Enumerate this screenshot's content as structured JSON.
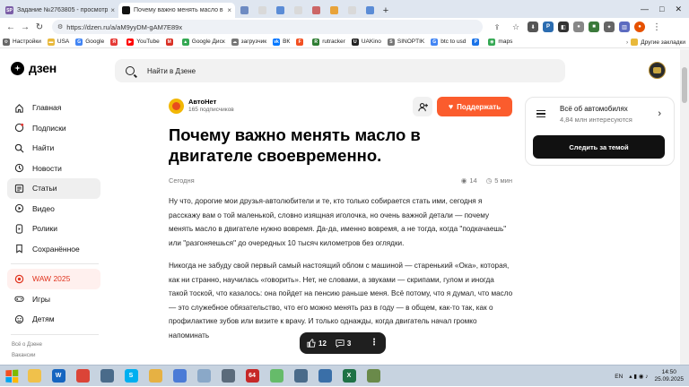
{
  "browser": {
    "tabs": [
      {
        "label": "Задание №2763805 - просмотр з",
        "favicon_text": "SP",
        "favicon_color": "#7b5ea7",
        "active": false
      },
      {
        "label": "Почему важно менять масло в д",
        "favicon_text": "",
        "favicon_color": "#111111",
        "active": true
      }
    ],
    "mini_tab_colors": [
      "#6e8bc2",
      "#d9d9d9",
      "#5b8cd6",
      "#d9d9d9",
      "#c66",
      "#e8a33a",
      "#d9d9d9",
      "#5b8cd6"
    ],
    "new_tab_label": "+",
    "window_controls": [
      "—",
      "□",
      "✕"
    ],
    "url": "https://dzen.ru/a/aM9yyDM-gAM7E89x",
    "bookmarks": [
      {
        "label": "Настройки",
        "icon": "gear-icon",
        "color": "#666666"
      },
      {
        "label": "USA",
        "icon": "folder-icon",
        "color": "#e8b83a"
      },
      {
        "label": "Google",
        "icon": "G",
        "color": "#4285f4"
      },
      {
        "label": "",
        "icon": "Я",
        "color": "#e53935"
      },
      {
        "label": "YouTube",
        "icon": "▶",
        "color": "#ff0000"
      },
      {
        "label": "",
        "icon": "M",
        "color": "#d93025"
      },
      {
        "label": "Google Диск",
        "icon": "▲",
        "color": "#34a853"
      },
      {
        "label": "загрузчик",
        "icon": "☁",
        "color": "#777777"
      },
      {
        "label": "ВК",
        "icon": "vk",
        "color": "#0077ff"
      },
      {
        "label": "",
        "icon": "F",
        "color": "#f25022"
      },
      {
        "label": "rutracker",
        "icon": "R",
        "color": "#2e7d32"
      },
      {
        "label": "UAKino",
        "icon": "U",
        "color": "#222222"
      },
      {
        "label": "SINOPTIK",
        "icon": "S",
        "color": "#777777"
      },
      {
        "label": "btc to usd",
        "icon": "G",
        "color": "#4285f4"
      },
      {
        "label": "",
        "icon": "P",
        "color": "#1a73e8"
      },
      {
        "label": "maps",
        "icon": "◉",
        "color": "#34a853"
      }
    ],
    "other_bookmarks": "Другие закладки"
  },
  "dzen": {
    "logo": "дзен",
    "search_placeholder": "Найти в Дзене",
    "sidebar": {
      "items": [
        {
          "label": "Главная",
          "icon": "home-icon",
          "active": false
        },
        {
          "label": "Подписки",
          "icon": "subscriptions-icon",
          "active": false
        },
        {
          "label": "Найти",
          "icon": "search-icon",
          "active": false
        },
        {
          "label": "Новости",
          "icon": "news-icon",
          "active": false
        },
        {
          "label": "Статьи",
          "icon": "articles-icon",
          "active": true
        },
        {
          "label": "Видео",
          "icon": "video-icon",
          "active": false
        },
        {
          "label": "Ролики",
          "icon": "shorts-icon",
          "active": false
        },
        {
          "label": "Сохранённое",
          "icon": "bookmark-icon",
          "active": false
        }
      ],
      "waw": "WAW 2025",
      "extra": [
        {
          "label": "Игры",
          "icon": "games-icon"
        },
        {
          "label": "Детям",
          "icon": "kids-icon"
        }
      ],
      "footer": [
        "Всё о Дзене",
        "Вакансии"
      ]
    },
    "author": {
      "name": "АвтоНет",
      "subscribers": "165 подписчиков"
    },
    "support_label": "Поддержать",
    "article": {
      "title": "Почему важно менять масло в двигателе своевременно.",
      "date": "Сегодня",
      "views": "14",
      "read_time": "5 мин",
      "paragraphs": [
        "Ну что, дорогие мои друзья-автолюбители и те, кто только собирается стать ими, сегодня я расскажу вам о той маленькой, словно изящная иголочка, но очень важной детали — почему менять масло в двигателе нужно вовремя. Да-да, именно вовремя, а не тогда, когда \"подкачаешь\" или \"разгоняешься\" до очередных 10 тысяч километров без оглядки.",
        "Никогда не забуду свой первый самый настоящий облом с машиной — старенький «Ока», которая, как ни странно, научилась «говорить». Нет, не словами, а звуками — скрипами, гулом и иногда такой тоской, что казалось: она пойдет на пенсию раньше меня. Всё потому, что я думал, что масло — это служебное обязательство, что его можно менять раз в году — в общем, как-то так, как о профилактике зубов или визите к врачу. И только однажды, когда двигатель начал громко напоминать"
      ]
    },
    "topic": {
      "name": "Всё об автомобилях",
      "count": "4,84 млн интересуются",
      "follow_label": "Следить за темой"
    },
    "actions": {
      "likes": "12",
      "comments": "3"
    }
  },
  "taskbar": {
    "apps": [
      {
        "icon": "explorer-icon",
        "color": "#f0c14b",
        "label": ""
      },
      {
        "icon": "wondershare-icon",
        "color": "#1565c0",
        "label": "W"
      },
      {
        "icon": "chrome-icon",
        "color": "#db4437",
        "label": ""
      },
      {
        "icon": "calculator-icon",
        "color": "#4a6b8a",
        "label": ""
      },
      {
        "icon": "skype-icon",
        "color": "#00aff0",
        "label": "S"
      },
      {
        "icon": "folder-icon",
        "color": "#e6b143",
        "label": ""
      },
      {
        "icon": "app-icon",
        "color": "#4b7bd6",
        "label": ""
      },
      {
        "icon": "notepad-icon",
        "color": "#8aa8c8",
        "label": ""
      },
      {
        "icon": "media-icon",
        "color": "#5b6b7b",
        "label": ""
      },
      {
        "icon": "aimp-icon",
        "color": "#c62828",
        "label": "64"
      },
      {
        "icon": "paint-icon",
        "color": "#66bb6a",
        "label": ""
      },
      {
        "icon": "network-icon",
        "color": "#4a6b8a",
        "label": ""
      },
      {
        "icon": "screen-icon",
        "color": "#3a6fa8",
        "label": ""
      },
      {
        "icon": "excel-icon",
        "color": "#1e7145",
        "label": "X"
      },
      {
        "icon": "table-icon",
        "color": "#6a8a4a",
        "label": ""
      }
    ],
    "lang": "EN",
    "time": "14:50",
    "date": "25.09.2025"
  }
}
